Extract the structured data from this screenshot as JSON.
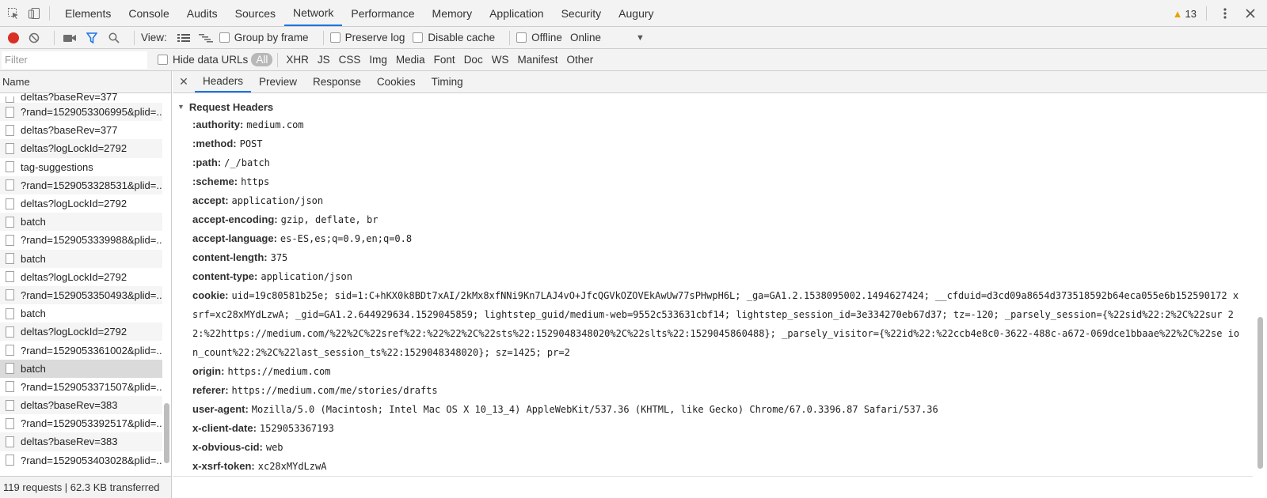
{
  "top_tabs": [
    "Elements",
    "Console",
    "Audits",
    "Sources",
    "Network",
    "Performance",
    "Memory",
    "Application",
    "Security",
    "Augury"
  ],
  "active_tab": "Network",
  "warnings_count": "13",
  "toolbar": {
    "view_label": "View:",
    "group_by_frame": "Group by frame",
    "preserve_log": "Preserve log",
    "disable_cache": "Disable cache",
    "offline": "Offline",
    "throttling": "Online"
  },
  "filter": {
    "placeholder": "Filter",
    "hide_data_urls": "Hide data URLs",
    "types": [
      "All",
      "XHR",
      "JS",
      "CSS",
      "Img",
      "Media",
      "Font",
      "Doc",
      "WS",
      "Manifest",
      "Other"
    ]
  },
  "requests": {
    "column_name": "Name",
    "items": [
      "deltas?baseRev=377",
      "?rand=1529053306995&plid=...",
      "deltas?baseRev=377",
      "deltas?logLockId=2792",
      "tag-suggestions",
      "?rand=1529053328531&plid=...",
      "deltas?logLockId=2792",
      "batch",
      "?rand=1529053339988&plid=...",
      "batch",
      "deltas?logLockId=2792",
      "?rand=1529053350493&plid=...",
      "batch",
      "deltas?logLockId=2792",
      "?rand=1529053361002&plid=...",
      "batch",
      "?rand=1529053371507&plid=...",
      "deltas?baseRev=383",
      "?rand=1529053392517&plid=...",
      "deltas?baseRev=383",
      "?rand=1529053403028&plid=..."
    ],
    "selected_index": 15,
    "summary": "119 requests | 62.3 KB transferred"
  },
  "detail_tabs": [
    "Headers",
    "Preview",
    "Response",
    "Cookies",
    "Timing"
  ],
  "active_detail_tab": "Headers",
  "request_headers": {
    "title": "Request Headers",
    "items": [
      {
        "name": ":authority:",
        "value": "medium.com"
      },
      {
        "name": ":method:",
        "value": "POST"
      },
      {
        "name": ":path:",
        "value": "/_/batch"
      },
      {
        "name": ":scheme:",
        "value": "https"
      },
      {
        "name": "accept:",
        "value": "application/json"
      },
      {
        "name": "accept-encoding:",
        "value": "gzip, deflate, br"
      },
      {
        "name": "accept-language:",
        "value": "es-ES,es;q=0.9,en;q=0.8"
      },
      {
        "name": "content-length:",
        "value": "375"
      },
      {
        "name": "content-type:",
        "value": "application/json"
      },
      {
        "name": "cookie:",
        "value": "uid=19c80581b25e; sid=1:C+hKX0k8BDt7xAI/2kMx8xfNNi9Kn7LAJ4vO+JfcQGVkOZOVEkAwUw77sPHwpH6L; _ga=GA1.2.1538095002.1494627424; __cfduid=d3cd09a8654d373518592b64eca055e6b152590172 xsrf=xc28xMYdLzwA; _gid=GA1.2.644929634.1529045859; lightstep_guid/medium-web=9552c533631cbf14; lightstep_session_id=3e334270eb67d37; tz=-120; _parsely_session={%22sid%22:2%2C%22sur 22:%22https://medium.com/%22%2C%22sref%22:%22%22%2C%22sts%22:1529048348020%2C%22slts%22:1529045860488}; _parsely_visitor={%22id%22:%22ccb4e8c0-3622-488c-a672-069dce1bbaae%22%2C%22se ion_count%22:2%2C%22last_session_ts%22:1529048348020}; sz=1425; pr=2"
      },
      {
        "name": "origin:",
        "value": "https://medium.com"
      },
      {
        "name": "referer:",
        "value": "https://medium.com/me/stories/drafts"
      },
      {
        "name": "user-agent:",
        "value": "Mozilla/5.0 (Macintosh; Intel Mac OS X 10_13_4) AppleWebKit/537.36 (KHTML, like Gecko) Chrome/67.0.3396.87 Safari/537.36"
      },
      {
        "name": "x-client-date:",
        "value": "1529053367193"
      },
      {
        "name": "x-obvious-cid:",
        "value": "web"
      },
      {
        "name": "x-xsrf-token:",
        "value": "xc28xMYdLzwA"
      }
    ]
  },
  "colors": {
    "accent": "#1a73e8",
    "record": "#d93025",
    "warning": "#e8a400"
  }
}
